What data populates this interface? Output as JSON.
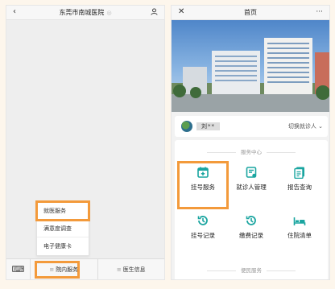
{
  "left": {
    "title": "东莞市南城医院",
    "back_icon": "chevron-left-icon",
    "profile_icon": "person-icon",
    "popup_menu": [
      "就医服务",
      "满意度调查",
      "电子健康卡"
    ],
    "bottom": {
      "menu1": "院内服务",
      "menu2": "医生信息"
    }
  },
  "right": {
    "title": "首页",
    "close_icon": "close-icon",
    "more_label": "···",
    "user_name": "刘**",
    "switch_label": "切换就诊人",
    "service_section": "服务中心",
    "services": [
      {
        "label": "挂号服务",
        "icon": "calendar-plus-icon"
      },
      {
        "label": "就诊人管理",
        "icon": "user-card-icon"
      },
      {
        "label": "报告查询",
        "icon": "document-icon"
      },
      {
        "label": "挂号记录",
        "icon": "history-icon"
      },
      {
        "label": "缴费记录",
        "icon": "history-icon"
      },
      {
        "label": "住院清单",
        "icon": "bed-icon"
      }
    ],
    "convenience_section": "便民服务"
  },
  "colors": {
    "accent": "#1aa5a0",
    "highlight": "#f39a3b"
  }
}
